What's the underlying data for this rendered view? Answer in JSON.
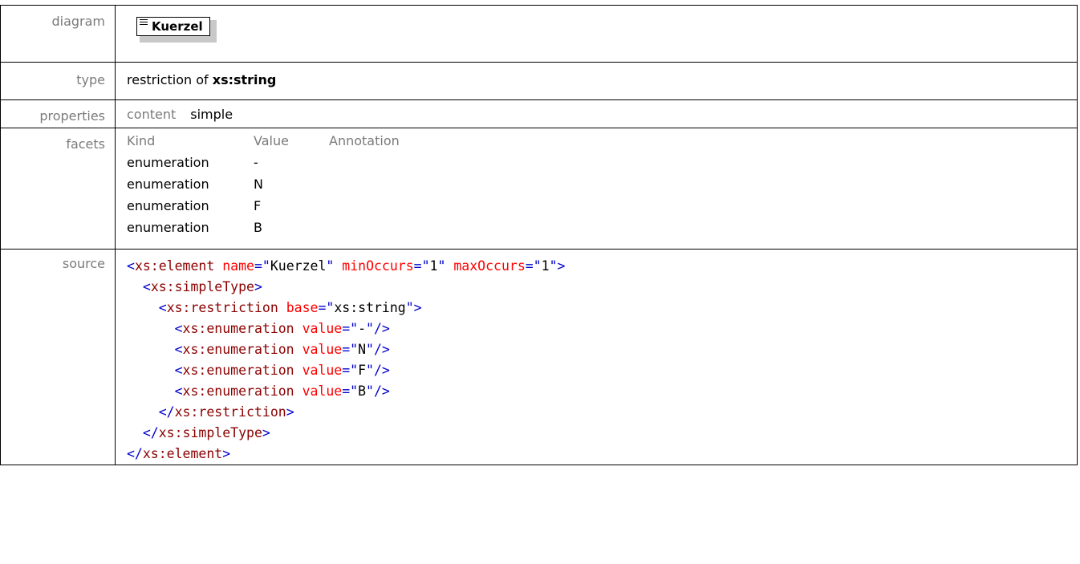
{
  "labels": {
    "diagram": "diagram",
    "type": "type",
    "properties": "properties",
    "facets": "facets",
    "source": "source"
  },
  "diagram": {
    "node_label": "Kuerzel",
    "icon": "element-icon"
  },
  "type": {
    "prefix": "restriction of",
    "base": "xs:string"
  },
  "properties": {
    "key": "content",
    "value": "simple"
  },
  "facets": {
    "headers": [
      "Kind",
      "Value",
      "Annotation"
    ],
    "rows": [
      {
        "kind": "enumeration",
        "value": "-"
      },
      {
        "kind": "enumeration",
        "value": "N"
      },
      {
        "kind": "enumeration",
        "value": "F"
      },
      {
        "kind": "enumeration",
        "value": "B"
      }
    ]
  },
  "source": {
    "element_open": "xs:element",
    "attr_name": "name",
    "attr_name_value": "Kuerzel",
    "attr_min": "minOccurs",
    "attr_min_value": "1",
    "attr_max": "maxOccurs",
    "attr_max_value": "1",
    "simpletype": "xs:simpleType",
    "restriction": "xs:restriction",
    "attr_base": "base",
    "attr_base_value": "xs:string",
    "enumeration": "xs:enumeration",
    "attr_value": "value",
    "enum_values": [
      "-",
      "N",
      "F",
      "B"
    ]
  },
  "colors": {
    "tag_blue": "#0000cc",
    "element_darkred": "#8b0000",
    "attr_red": "#ff0000",
    "label_gray": "#7a7a7a"
  }
}
